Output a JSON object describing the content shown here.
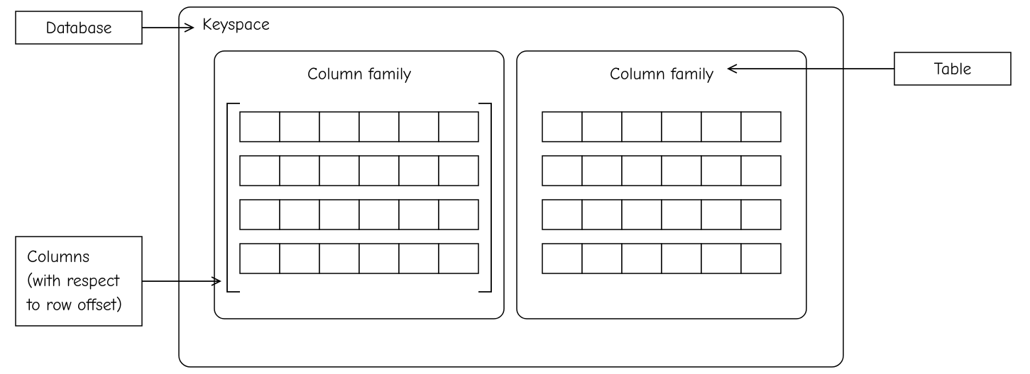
{
  "labels": {
    "database": "Database",
    "keyspace": "Keyspace",
    "column_family_left": "Column family",
    "column_family_right": "Column family",
    "table": "Table",
    "columns_line1": "Columns",
    "columns_line2": "(with respect",
    "columns_line3": "to row offset)"
  },
  "grid": {
    "rows": 4,
    "cols": 6
  }
}
